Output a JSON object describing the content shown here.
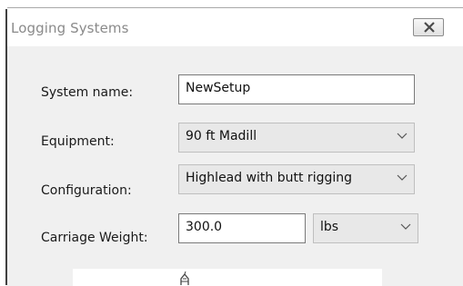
{
  "window": {
    "title": "Logging Systems"
  },
  "form": {
    "system_name_label": "System name:",
    "system_name_value": "NewSetup",
    "equipment_label": "Equipment:",
    "equipment_value": "90 ft Madill",
    "configuration_label": "Configuration:",
    "configuration_value": "Highlead with butt rigging",
    "carriage_weight_label": "Carriage Weight:",
    "carriage_weight_value": "300.0",
    "carriage_weight_unit": "lbs"
  },
  "icons": {
    "close": "close-icon",
    "dropdown": "chevron-down-icon",
    "preview": "machine-icon"
  },
  "colors": {
    "title_text": "#8a8a8a",
    "window_bg": "#f0f0f0",
    "combo_bg": "#e8e8e8"
  }
}
